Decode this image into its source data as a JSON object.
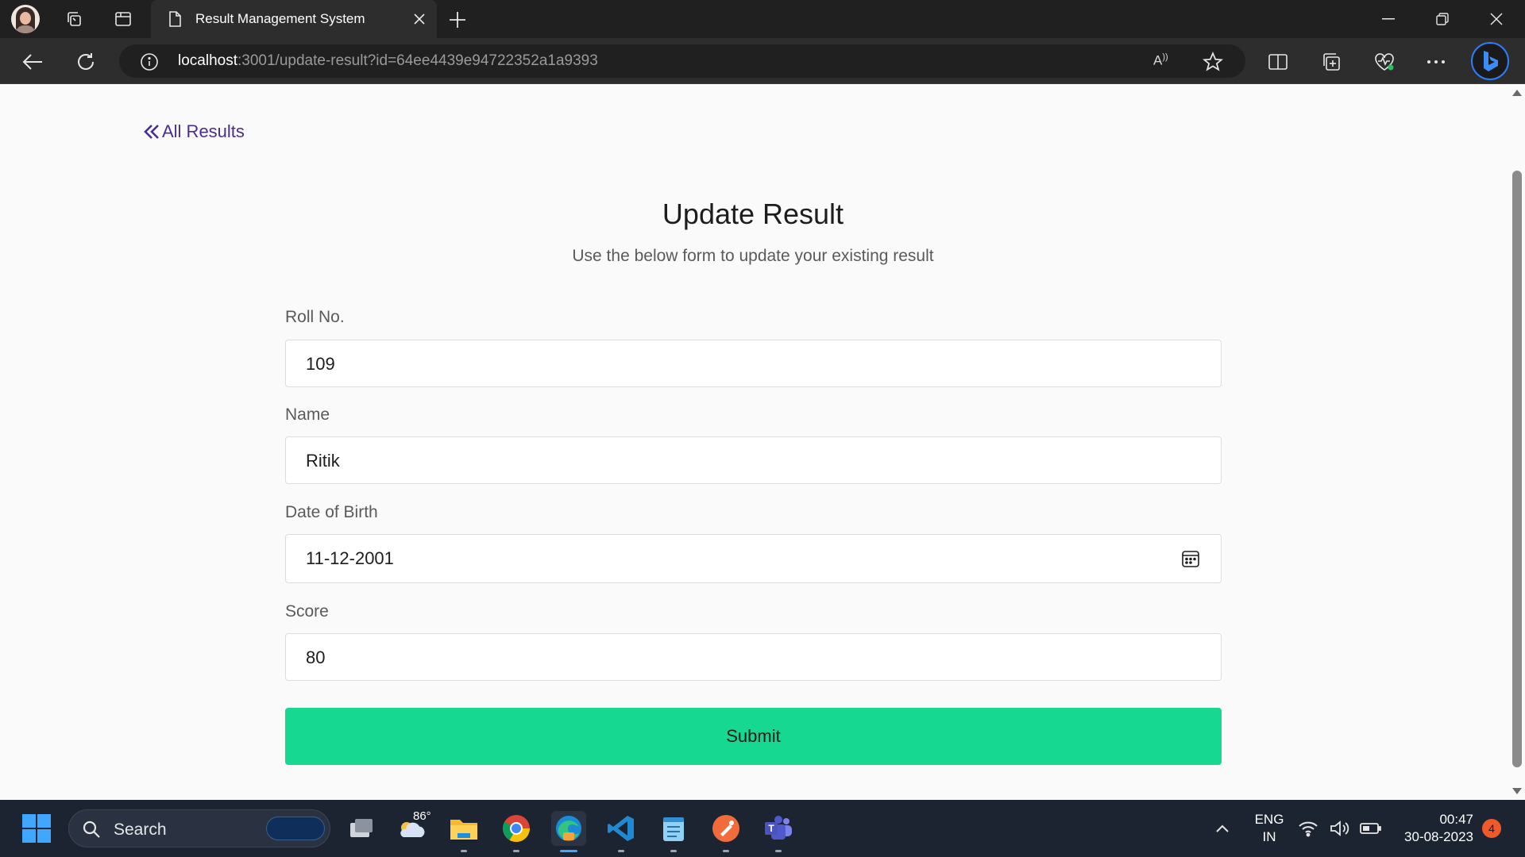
{
  "browser": {
    "tab_title": "Result Management System",
    "url_host": "localhost",
    "url_rest": ":3001/update-result?id=64ee4439e94722352a1a9393",
    "read_aloud_glyph": "Ă"
  },
  "page": {
    "back_link": "All Results",
    "title": "Update Result",
    "subtitle": "Use the below form to update your existing result",
    "fields": {
      "roll": {
        "label": "Roll No.",
        "value": "109"
      },
      "name": {
        "label": "Name",
        "value": "Ritik"
      },
      "dob": {
        "label": "Date of Birth",
        "value": "11-12-2001"
      },
      "score": {
        "label": "Score",
        "value": "80"
      }
    },
    "submit_label": "Submit"
  },
  "taskbar": {
    "search_label": "Search",
    "weather_temp": "86°",
    "lang_line1": "ENG",
    "lang_line2": "IN",
    "time": "00:47",
    "date": "30-08-2023",
    "notification_count": "4"
  },
  "colors": {
    "accent_submit": "#17d891",
    "back_link": "#4a2e8f",
    "taskbar_bg": "#1c2431"
  },
  "icons": [
    "profile-avatar",
    "workspaces-icon",
    "tab-actions-icon",
    "page-icon",
    "close-icon",
    "plus-icon",
    "minimize-icon",
    "restore-icon",
    "back-arrow-icon",
    "refresh-icon",
    "info-icon",
    "read-aloud-icon",
    "favorite-star-icon",
    "split-screen-icon",
    "collections-icon",
    "health-icon",
    "more-icon",
    "bing-icon",
    "calendar-icon",
    "windows-start-icon",
    "search-icon",
    "task-view-icon",
    "weather-icon",
    "file-explorer-icon",
    "chrome-icon",
    "edge-icon",
    "vscode-icon",
    "notepad-icon",
    "postman-icon",
    "teams-icon",
    "chevron-up-icon",
    "wifi-icon",
    "volume-icon",
    "battery-icon"
  ]
}
